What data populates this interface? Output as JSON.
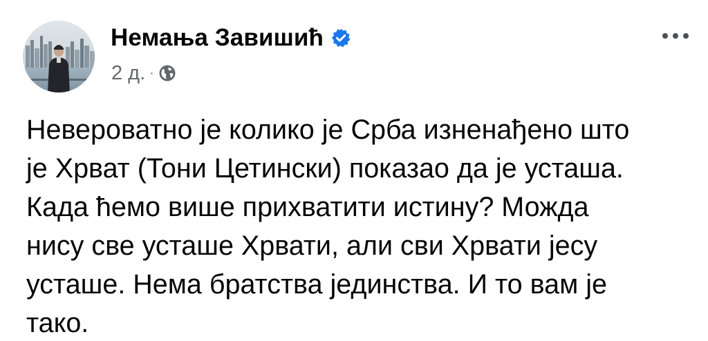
{
  "author": {
    "name": "Немања Завишић",
    "verified": true
  },
  "meta": {
    "time": "2 д.",
    "separator": "·",
    "audience_icon": "globe-icon"
  },
  "more_icon": "more-horizontal-icon",
  "post": {
    "lines": [
      "Невероватно је колико је Срба изненађено што",
      "је Хрват (Тони Цетински) показао да је усташа.",
      "Када ћемо више прихватити истину? Можда",
      "нису све усташе Хрвати, али сви Хрвати јесу",
      "усташе. Нема братства јединства. И то вам је",
      "тако."
    ]
  },
  "colors": {
    "verified_badge": "#1877f2",
    "secondary_text": "#65676b",
    "primary_text": "#050505"
  }
}
